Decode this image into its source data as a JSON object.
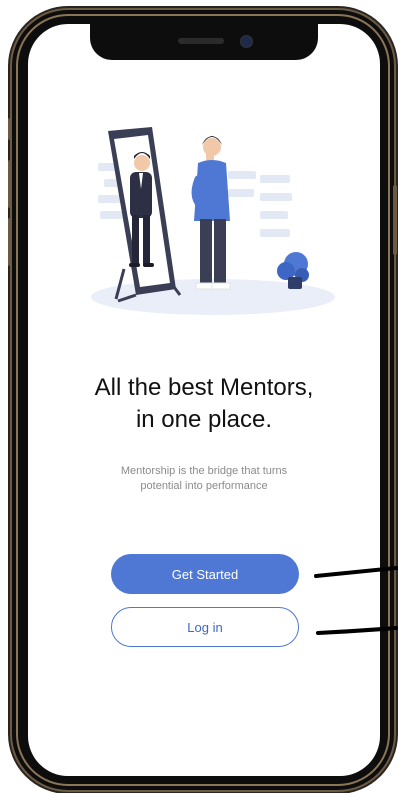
{
  "headline": {
    "line1": "All the best Mentors,",
    "line2": "in one place."
  },
  "subtitle": {
    "line1": "Mentorship is the bridge that turns",
    "line2": "potential into performance"
  },
  "buttons": {
    "get_started": "Get Started",
    "login": "Log in"
  },
  "illustration": {
    "icon": "man-in-mirror-illustration"
  },
  "colors": {
    "primary": "#4f78d4",
    "headline": "#111111",
    "subtitle": "#8b8b8b",
    "screen": "#ffffff",
    "frame": "#0d0d0d",
    "frame_accent": "#8a7556"
  }
}
